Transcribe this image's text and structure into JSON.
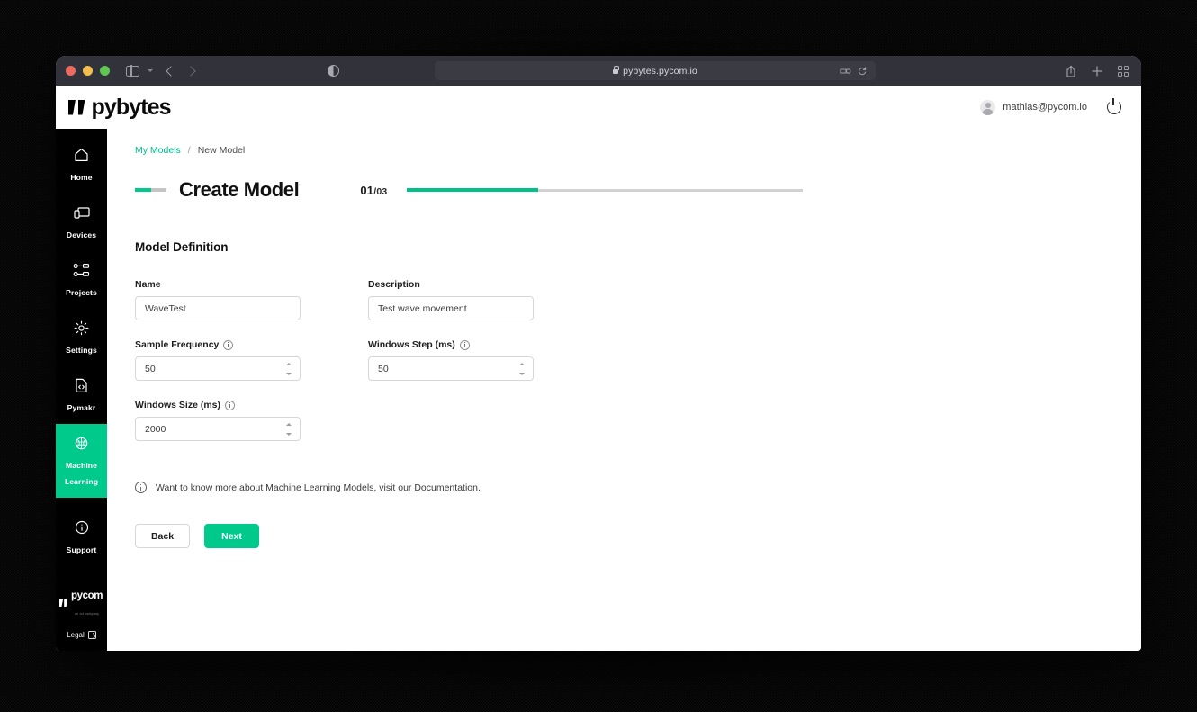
{
  "browser": {
    "url": "pybytes.pycom.io",
    "lock_icon": "lock-icon",
    "traffic_lights": [
      "close",
      "minimize",
      "maximize"
    ],
    "sidebar_toggle_icon": "sidebar-toggle-icon",
    "back_icon": "back-arrow-icon",
    "forward_icon": "forward-arrow-icon",
    "reader_icon": "reader-contrast-icon",
    "extensions_icon": "extensions-icon",
    "reload_icon": "reload-icon",
    "share_icon": "share-icon",
    "new_tab_icon": "plus-icon",
    "tab_overview_icon": "tab-overview-icon"
  },
  "header": {
    "logo_text": "pybytes",
    "user_email": "mathias@pycom.io",
    "power_icon": "power-icon",
    "avatar_icon": "avatar-icon"
  },
  "sidebar": {
    "items": [
      {
        "label": "Home",
        "icon": "home-icon",
        "active": false
      },
      {
        "label": "Devices",
        "icon": "monitor-icon",
        "active": false
      },
      {
        "label": "Projects",
        "icon": "nodes-icon",
        "active": false
      },
      {
        "label": "Settings",
        "icon": "gear-icon",
        "active": false
      },
      {
        "label": "Pymakr",
        "icon": "code-file-icon",
        "active": false
      },
      {
        "label": "Machine Learning",
        "label_line1": "Machine",
        "label_line2": "Learning",
        "icon": "brain-icon",
        "active": true
      },
      {
        "label": "Support",
        "icon": "info-circle-icon",
        "active": false
      }
    ],
    "footer": {
      "logo_text": "pycom",
      "logo_sub": "an iot company",
      "legal_label": "Legal",
      "legal_icon": "external-link-icon"
    }
  },
  "breadcrumb": {
    "parent": "My Models",
    "separator": "/",
    "current": "New Model"
  },
  "page": {
    "title": "Create Model",
    "step_current": "01",
    "step_total": "/03",
    "progress_percent": 33
  },
  "form": {
    "section_title": "Model Definition",
    "fields": [
      {
        "label": "Name",
        "value": "WaveTest",
        "type": "text",
        "has_info": false
      },
      {
        "label": "Description",
        "value": "Test wave movement",
        "type": "text",
        "has_info": false
      },
      {
        "label": "Sample Frequency",
        "value": "50",
        "type": "number",
        "has_info": true
      },
      {
        "label": "Windows Step (ms)",
        "value": "50",
        "type": "number",
        "has_info": true
      },
      {
        "label": "Windows Size (ms)",
        "value": "2000",
        "type": "number",
        "has_info": true
      }
    ]
  },
  "note": {
    "icon": "info-circle-icon",
    "text": "Want to know more about Machine Learning Models, visit our Documentation."
  },
  "buttons": {
    "back_label": "Back",
    "next_label": "Next"
  },
  "colors": {
    "accent_green": "#00c98c",
    "link_green": "#00c18a",
    "sidebar_black": "#000000",
    "toolbar_grey": "#32323a"
  }
}
